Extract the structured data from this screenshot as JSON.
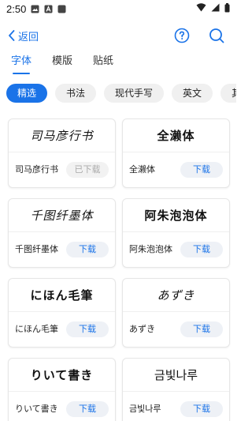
{
  "status_bar": {
    "time": "2:50",
    "left_icons": [
      "image-icon",
      "text-a-icon",
      "square-icon"
    ],
    "right_icons": [
      "wifi-icon",
      "signal-icon",
      "battery-icon"
    ]
  },
  "top_bar": {
    "back_label": "返回",
    "help_icon": "help-circle-icon",
    "search_icon": "search-icon"
  },
  "main_tabs": [
    {
      "label": "字体",
      "active": true
    },
    {
      "label": "模版",
      "active": false
    },
    {
      "label": "贴纸",
      "active": false
    }
  ],
  "chips": [
    {
      "label": "精选",
      "active": true
    },
    {
      "label": "书法",
      "active": false
    },
    {
      "label": "现代手写",
      "active": false
    },
    {
      "label": "英文",
      "active": false
    },
    {
      "label": "其",
      "active": false
    }
  ],
  "fonts": [
    {
      "preview": "司马彦行书",
      "name": "司马彦行书",
      "button": "已下载",
      "downloaded": true,
      "style": "script"
    },
    {
      "preview": "全濑体",
      "name": "全濑体",
      "button": "下载",
      "downloaded": false,
      "style": "bold"
    },
    {
      "preview": "千图纤墨体",
      "name": "千图纤墨体",
      "button": "下载",
      "downloaded": false,
      "style": "script"
    },
    {
      "preview": "阿朱泡泡体",
      "name": "阿朱泡泡体",
      "button": "下载",
      "downloaded": false,
      "style": "bold"
    },
    {
      "preview": "にほん毛筆",
      "name": "にほん毛筆",
      "button": "下载",
      "downloaded": false,
      "style": "bold"
    },
    {
      "preview": "あずき",
      "name": "あずき",
      "button": "下载",
      "downloaded": false,
      "style": "script"
    },
    {
      "preview": "りいて書き",
      "name": "りいて書き",
      "button": "下载",
      "downloaded": false,
      "style": "bold"
    },
    {
      "preview": "금빛나루",
      "name": "금빛나루",
      "button": "下载",
      "downloaded": false,
      "style": "plain"
    }
  ],
  "colors": {
    "accent": "#1a73e8",
    "chip_bg": "#f0f0f0",
    "card_border": "#e6e6e6"
  }
}
